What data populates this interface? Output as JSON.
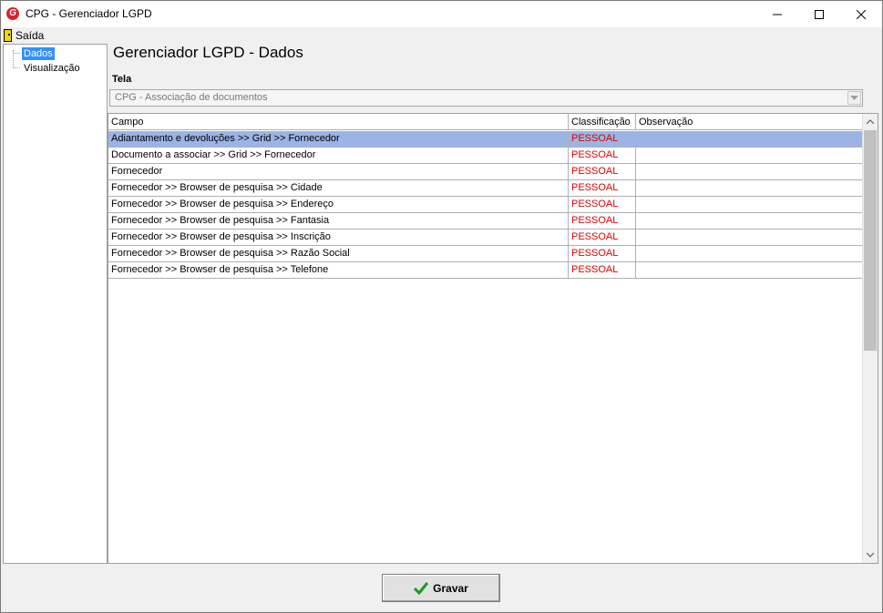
{
  "window": {
    "title": "CPG - Gerenciador LGPD",
    "app_icon_letter": "G"
  },
  "menu": {
    "exit_label": "Saída"
  },
  "tree": {
    "items": [
      {
        "label": "Dados",
        "selected": true
      },
      {
        "label": "Visualização",
        "selected": false
      }
    ]
  },
  "main": {
    "heading": "Gerenciador LGPD - Dados",
    "tela_label": "Tela",
    "tela_value": "CPG - Associação de documentos"
  },
  "grid": {
    "columns": [
      "Campo",
      "Classificação",
      "Observação"
    ],
    "rows": [
      {
        "campo": "Adiantamento e devoluções >> Grid >> Fornecedor",
        "classificacao": "PESSOAL",
        "observacao": ""
      },
      {
        "campo": "Documento a associar >> Grid >> Fornecedor",
        "classificacao": "PESSOAL",
        "observacao": ""
      },
      {
        "campo": "Fornecedor",
        "classificacao": "PESSOAL",
        "observacao": ""
      },
      {
        "campo": "Fornecedor >> Browser de pesquisa >> Cidade",
        "classificacao": "PESSOAL",
        "observacao": ""
      },
      {
        "campo": "Fornecedor >> Browser de pesquisa >> Endereço",
        "classificacao": "PESSOAL",
        "observacao": ""
      },
      {
        "campo": "Fornecedor >> Browser de pesquisa >> Fantasia",
        "classificacao": "PESSOAL",
        "observacao": ""
      },
      {
        "campo": "Fornecedor >> Browser de pesquisa >> Inscrição",
        "classificacao": "PESSOAL",
        "observacao": ""
      },
      {
        "campo": "Fornecedor >> Browser de pesquisa >> Razão Social",
        "classificacao": "PESSOAL",
        "observacao": ""
      },
      {
        "campo": "Fornecedor >> Browser de pesquisa >> Telefone",
        "classificacao": "PESSOAL",
        "observacao": ""
      }
    ]
  },
  "footer": {
    "save_label": "Gravar"
  },
  "colors": {
    "selected_row": "#9ab4e6",
    "classification_text": "#e00000",
    "tree_selected": "#3390ff"
  },
  "icons": {
    "app": "app-logo-icon",
    "exit": "exit-door-icon",
    "save": "checkmark-icon"
  }
}
